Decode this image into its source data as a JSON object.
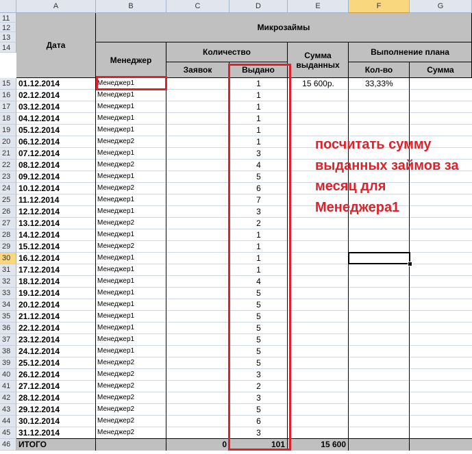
{
  "columns": [
    "A",
    "B",
    "C",
    "D",
    "E",
    "F",
    "G"
  ],
  "header_rows": [
    "11",
    "12",
    "13",
    "14"
  ],
  "headers": {
    "date": "Дата",
    "microloans": "Микрозаймы",
    "manager": "Менеджер",
    "quantity": "Количество",
    "sum_issued": "Сумма выданных",
    "plan": "Выполнение плана",
    "applications": "Заявок",
    "issued": "Выдано",
    "plan_count": "Кол-во",
    "plan_sum": "Сумма"
  },
  "rows": [
    {
      "row": "15",
      "date": "01.12.2014",
      "manager": "Менеджер1",
      "issued": "1",
      "sum": "15 600р.",
      "plan_count": "33,33%"
    },
    {
      "row": "16",
      "date": "02.12.2014",
      "manager": "Менеджер1",
      "issued": "1"
    },
    {
      "row": "17",
      "date": "03.12.2014",
      "manager": "Менеджер1",
      "issued": "1"
    },
    {
      "row": "18",
      "date": "04.12.2014",
      "manager": "Менеджер1",
      "issued": "1"
    },
    {
      "row": "19",
      "date": "05.12.2014",
      "manager": "Менеджер1",
      "issued": "1"
    },
    {
      "row": "20",
      "date": "06.12.2014",
      "manager": "Менеджер2",
      "issued": "1"
    },
    {
      "row": "21",
      "date": "07.12.2014",
      "manager": "Менеджер1",
      "issued": "3"
    },
    {
      "row": "22",
      "date": "08.12.2014",
      "manager": "Менеджер2",
      "issued": "4"
    },
    {
      "row": "23",
      "date": "09.12.2014",
      "manager": "Менеджер1",
      "issued": "5"
    },
    {
      "row": "24",
      "date": "10.12.2014",
      "manager": "Менеджер2",
      "issued": "6"
    },
    {
      "row": "25",
      "date": "11.12.2014",
      "manager": "Менеджер1",
      "issued": "7"
    },
    {
      "row": "26",
      "date": "12.12.2014",
      "manager": "Менеджер1",
      "issued": "3"
    },
    {
      "row": "27",
      "date": "13.12.2014",
      "manager": "Менеджер2",
      "issued": "2"
    },
    {
      "row": "28",
      "date": "14.12.2014",
      "manager": "Менеджер1",
      "issued": "1"
    },
    {
      "row": "29",
      "date": "15.12.2014",
      "manager": "Менеджер2",
      "issued": "1"
    },
    {
      "row": "30",
      "date": "16.12.2014",
      "manager": "Менеджер1",
      "issued": "1"
    },
    {
      "row": "31",
      "date": "17.12.2014",
      "manager": "Менеджер1",
      "issued": "1"
    },
    {
      "row": "32",
      "date": "18.12.2014",
      "manager": "Менеджер1",
      "issued": "4"
    },
    {
      "row": "33",
      "date": "19.12.2014",
      "manager": "Менеджер1",
      "issued": "5"
    },
    {
      "row": "34",
      "date": "20.12.2014",
      "manager": "Менеджер1",
      "issued": "5"
    },
    {
      "row": "35",
      "date": "21.12.2014",
      "manager": "Менеджер1",
      "issued": "5"
    },
    {
      "row": "36",
      "date": "22.12.2014",
      "manager": "Менеджер1",
      "issued": "5"
    },
    {
      "row": "37",
      "date": "23.12.2014",
      "manager": "Менеджер1",
      "issued": "5"
    },
    {
      "row": "38",
      "date": "24.12.2014",
      "manager": "Менеджер1",
      "issued": "5"
    },
    {
      "row": "39",
      "date": "25.12.2014",
      "manager": "Менеджер2",
      "issued": "5"
    },
    {
      "row": "40",
      "date": "26.12.2014",
      "manager": "Менеджер2",
      "issued": "3"
    },
    {
      "row": "41",
      "date": "27.12.2014",
      "manager": "Менеджер2",
      "issued": "2"
    },
    {
      "row": "42",
      "date": "28.12.2014",
      "manager": "Менеджер2",
      "issued": "3"
    },
    {
      "row": "43",
      "date": "29.12.2014",
      "manager": "Менеджер2",
      "issued": "5"
    },
    {
      "row": "44",
      "date": "30.12.2014",
      "manager": "Менеджер2",
      "issued": "6"
    },
    {
      "row": "45",
      "date": "31.12.2014",
      "manager": "Менеджер2",
      "issued": "3"
    }
  ],
  "total": {
    "row": "46",
    "label": "ИТОГО",
    "applications": "0",
    "issued": "101",
    "sum": "15 600"
  },
  "annotation": "посчитать сумму выданных займов за месяц для Менеджера1",
  "selected_cell": "F30",
  "colors": {
    "highlight": "#e0202a",
    "header_fill": "#c0c0c0",
    "selected_header": "#f8d77e"
  }
}
